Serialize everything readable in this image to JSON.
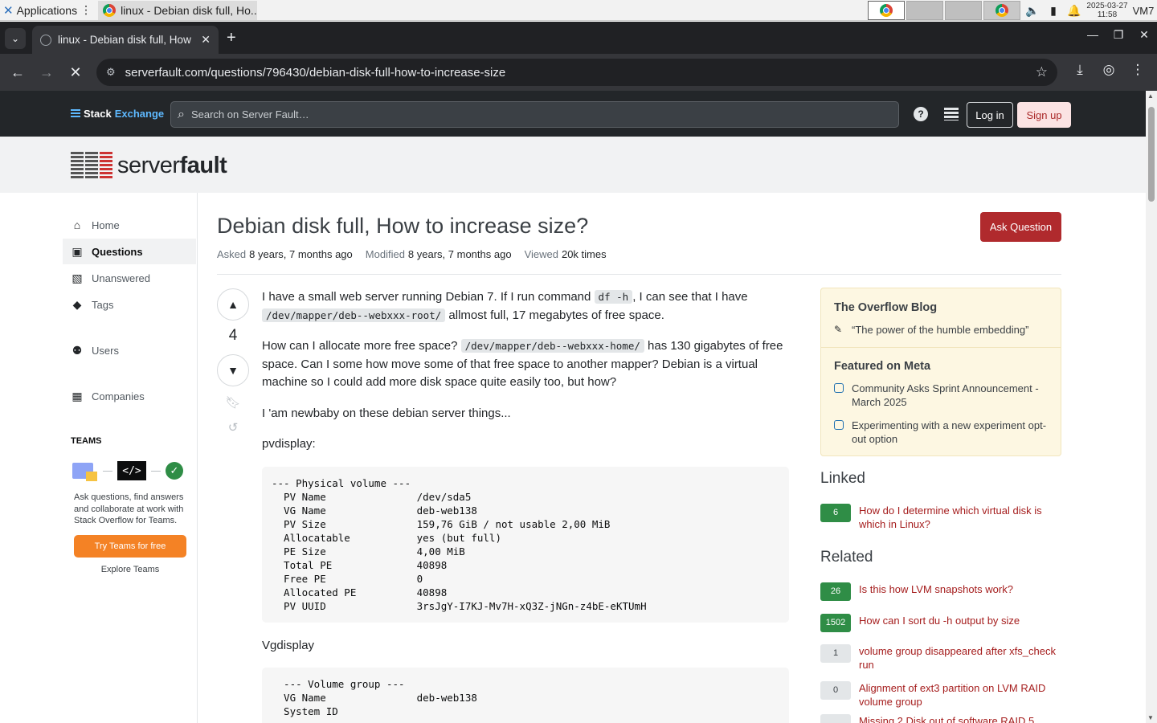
{
  "os": {
    "apps_label": "Applications",
    "task_title": "linux - Debian disk full, Ho...",
    "date": "2025-03-27",
    "time": "11:58",
    "vm_label": "VM7"
  },
  "browser": {
    "tab_title": "linux - Debian disk full, How",
    "url": "serverfault.com/questions/796430/debian-disk-full-how-to-increase-size"
  },
  "se": {
    "logo_stack": "Stack",
    "logo_exchange": "Exchange",
    "search_placeholder": "Search on Server Fault…",
    "help_glyph": "?",
    "login": "Log in",
    "signup": "Sign up"
  },
  "site": {
    "logo_server": "server",
    "logo_fault": "fault"
  },
  "nav": {
    "items": [
      {
        "label": "Home",
        "icon": "home-icon"
      },
      {
        "label": "Questions",
        "icon": "questions-icon"
      },
      {
        "label": "Unanswered",
        "icon": "unanswered-icon"
      },
      {
        "label": "Tags",
        "icon": "tag-icon"
      },
      {
        "label": "Users",
        "icon": "users-icon"
      },
      {
        "label": "Companies",
        "icon": "companies-icon"
      }
    ],
    "teams_heading": "TEAMS",
    "teams_desc": "Ask questions, find answers and collaborate at work with Stack Overflow for Teams.",
    "teams_button": "Try Teams for free",
    "teams_explore": "Explore Teams"
  },
  "question": {
    "title": "Debian disk full, How to increase size?",
    "ask_button": "Ask Question",
    "asked_label": "Asked",
    "asked_value": "8 years, 7 months ago",
    "modified_label": "Modified",
    "modified_value": "8 years, 7 months ago",
    "viewed_label": "Viewed",
    "viewed_value": "20k times",
    "votes": "4",
    "p1_a": "I have a small web server running Debian 7. If I run command ",
    "p1_code1": "df -h",
    "p1_b": ", I can see that I have ",
    "p1_code2": "/dev/mapper/deb--webxxx-root/",
    "p1_c": " allmost full, 17 megabytes of free space.",
    "p2_a": "How can I allocate more free space? ",
    "p2_code": "/dev/mapper/deb--webxxx-home/",
    "p2_b": " has 130 gigabytes of free space. Can I some how move some of that free space to another mapper? Debian is a virtual machine so I could add more disk space quite easily too, but how?",
    "p3": "I 'am newbaby on these debian server things...",
    "p4": "pvdisplay:",
    "pre1": "--- Physical volume ---\n  PV Name               /dev/sda5\n  VG Name               deb-web138\n  PV Size               159,76 GiB / not usable 2,00 MiB\n  Allocatable           yes (but full)\n  PE Size               4,00 MiB\n  Total PE              40898\n  Free PE               0\n  Allocated PE          40898\n  PV UUID               3rsJgY-I7KJ-Mv7H-xQ3Z-jNGn-z4bE-eKTUmH",
    "p5": "Vgdisplay",
    "pre2": "  --- Volume group ---\n  VG Name               deb-web138\n  System ID"
  },
  "sidebar": {
    "blog_heading": "The Overflow Blog",
    "blog_item": "“The power of the humble embedding”",
    "meta_heading": "Featured on Meta",
    "meta_items": [
      "Community Asks Sprint Announcement - March 2025",
      "Experimenting with a new experiment opt-out option"
    ],
    "linked_heading": "Linked",
    "linked": [
      {
        "count": "6",
        "title": "How do I determine which virtual disk is which in Linux?"
      }
    ],
    "related_heading": "Related",
    "related": [
      {
        "count": "26",
        "title": "Is this how LVM snapshots work?",
        "accepted": true
      },
      {
        "count": "1502",
        "title": "How can I sort du -h output by size",
        "accepted": true
      },
      {
        "count": "1",
        "title": "volume group disappeared after xfs_check run",
        "accepted": false
      },
      {
        "count": "0",
        "title": "Alignment of ext3 partition on LVM RAID volume group",
        "accepted": false
      },
      {
        "count": "",
        "title": "Missing 2 Disk out of software RAID 5",
        "accepted": false
      }
    ]
  },
  "colors": {
    "accent_red": "#b02a2d",
    "link_red": "#a51d1d",
    "teams_orange": "#f48225",
    "accepted_green": "#2f8d46"
  }
}
